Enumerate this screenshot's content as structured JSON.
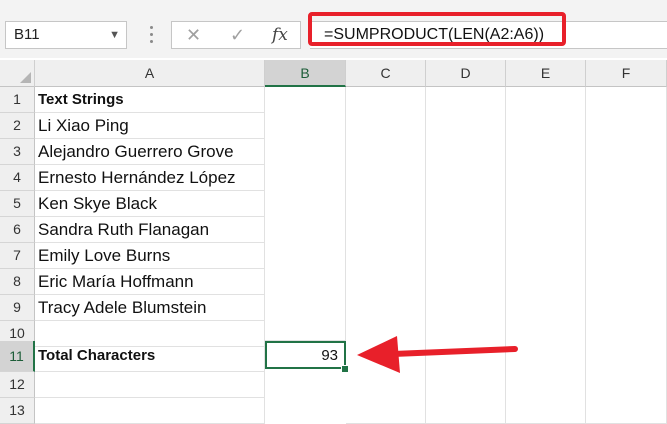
{
  "name_box": {
    "value": "B11"
  },
  "formula_bar": {
    "cancel_icon": "x-icon",
    "enter_icon": "check-icon",
    "function_label": "fx",
    "formula": "=SUMPRODUCT(LEN(A2:A6))"
  },
  "columns": [
    "A",
    "B",
    "C",
    "D",
    "E",
    "F"
  ],
  "rows": [
    "1",
    "2",
    "3",
    "4",
    "5",
    "6",
    "7",
    "8",
    "9",
    "10",
    "11",
    "12",
    "13"
  ],
  "cells": {
    "A1": "Text Strings",
    "A2": "Li Xiao Ping",
    "A3": "Alejandro Guerrero Grove",
    "A4": "Ernesto Hernández López",
    "A5": "Ken Skye Black",
    "A6": "Sandra Ruth Flanagan",
    "A7": "Emily Love Burns",
    "A8": "Eric María Hoffmann",
    "A9": "Tracy Adele Blumstein",
    "A11": "Total Characters",
    "B11": "93"
  },
  "selected_cell": "B11",
  "colors": {
    "highlight": "#e8202a",
    "selection": "#217346"
  }
}
